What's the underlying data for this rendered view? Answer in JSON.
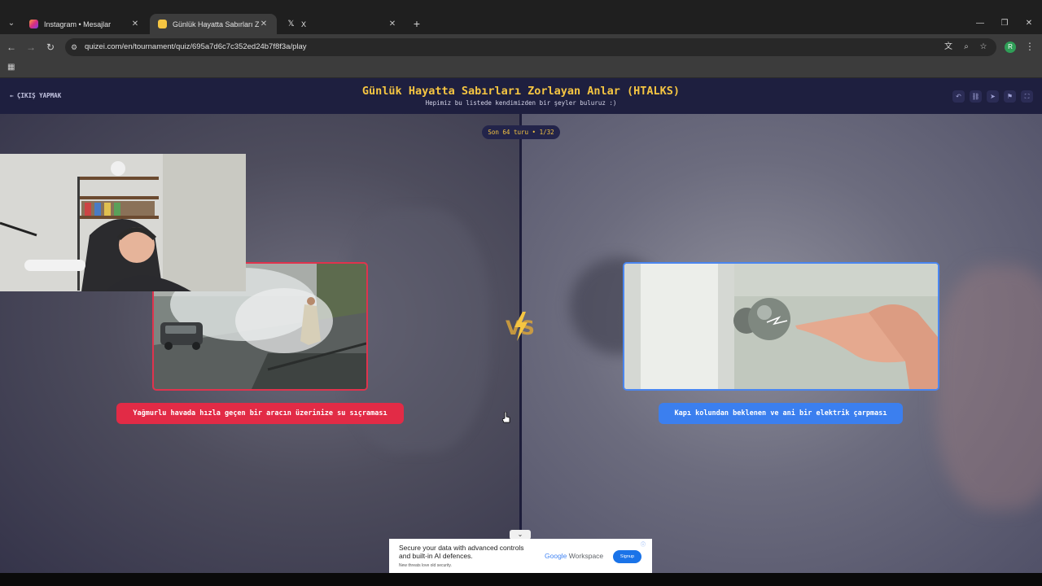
{
  "browser": {
    "tabs": [
      {
        "title": "Instagram • Mesajlar",
        "active": false
      },
      {
        "title": "Günlük Hayatta Sabırları Zorlayan Anlar (HTALKS)",
        "active": true
      },
      {
        "title": "X",
        "active": false
      }
    ],
    "url": "quizei.com/en/tournament/quiz/695a7d6c7c352ed24b7f8f3a/play",
    "profile_initial": "R",
    "icons": [
      "tab-search-icon",
      "back-icon",
      "forward-icon",
      "reload-icon",
      "site-info-icon",
      "translate-icon",
      "zoom-icon",
      "bookmark-star-icon",
      "menu-icon",
      "apps-grid-icon"
    ]
  },
  "header": {
    "exit_label": "ÇIKIŞ YAPMAK",
    "title": "Günlük Hayatta Sabırları Zorlayan Anlar (HTALKS)",
    "subtitle": "Hepimiz bu listede kendimizden bir şeyler buluruz :)",
    "action_icons": [
      "undo-icon",
      "link-icon",
      "send-icon",
      "flag-icon",
      "fullscreen-icon"
    ]
  },
  "round": {
    "label": "Son 64 turu • 1/32"
  },
  "left_option": {
    "caption": "Yağmurlu havada hızla geçen bir aracın üzerinize su sıçraması",
    "accent": "#e22b46"
  },
  "right_option": {
    "caption": "Kapı kolundan beklenen ve ani bir elektrik çarpması",
    "accent": "#3b7fef"
  },
  "vs_label": "VS",
  "ad": {
    "headline": "Secure your data with advanced controls and built-in AI defences.",
    "small": "New threats love old security.",
    "brand_google": "Google",
    "brand_rest": "Workspace",
    "cta": "Signup"
  },
  "colors": {
    "header_bg": "#1e1f3f",
    "title": "#f5c542",
    "left_border": "#e0334d",
    "right_border": "#4a86f0"
  }
}
